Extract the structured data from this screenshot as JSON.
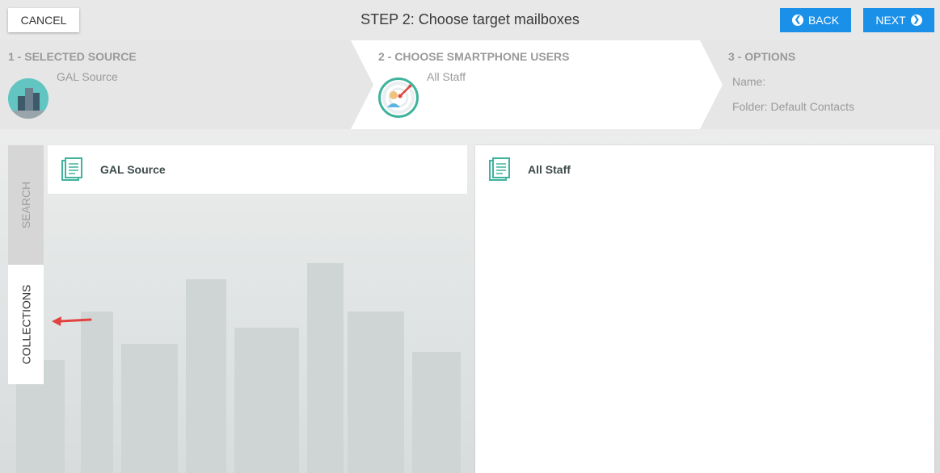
{
  "header": {
    "cancel_label": "CANCEL",
    "title": "STEP 2: Choose target mailboxes",
    "back_label": "BACK",
    "next_label": "NEXT"
  },
  "steps": [
    {
      "title": "1 - SELECTED SOURCE",
      "lines": [
        "GAL Source"
      ]
    },
    {
      "title": "2 - CHOOSE SMARTPHONE USERS",
      "lines": [
        "All Staff"
      ]
    },
    {
      "title": "3 - OPTIONS",
      "lines": [
        "Name:",
        "Folder: Default Contacts"
      ]
    }
  ],
  "side_tabs": {
    "search_label": "SEARCH",
    "collections_label": "COLLECTIONS"
  },
  "left_list": [
    {
      "label": "GAL Source"
    }
  ],
  "right_list": [
    {
      "label": "All Staff"
    }
  ],
  "colors": {
    "accent_blue": "#1a90e8",
    "teal": "#3fb39c",
    "arrow_red": "#e0433f"
  },
  "icons": {
    "back": "chevron-left-circle-icon",
    "next": "chevron-right-circle-icon",
    "source": "city-icon",
    "target": "target-user-icon",
    "collection_item": "document-icon"
  }
}
